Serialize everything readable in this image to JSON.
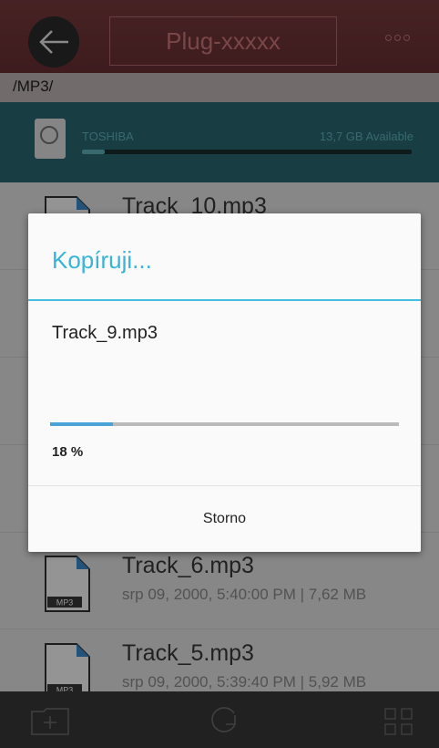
{
  "header": {
    "title": "Plug-xxxxx",
    "back_icon": "arrow-left-icon",
    "more_icon": "more-dots-icon"
  },
  "path": "/MP3/",
  "drive": {
    "name": "TOSHIBA",
    "available": "13,7 GB Available",
    "used_fraction": 0.07,
    "icon": "hard-drive-icon"
  },
  "files": [
    {
      "name": "Track_10.mp3",
      "meta": ""
    },
    {
      "name": "",
      "meta": ""
    },
    {
      "name": "",
      "meta": ""
    },
    {
      "name": "",
      "meta": ""
    },
    {
      "name": "Track_6.mp3",
      "meta": "srp 09, 2000, 5:40:00 PM | 7,62 MB",
      "badge": "MP3"
    },
    {
      "name": "Track_5.mp3",
      "meta": "srp 09, 2000, 5:39:40 PM | 5,92 MB",
      "badge": "MP3"
    }
  ],
  "dialog": {
    "title": "Kopíruji...",
    "filename": "Track_9.mp3",
    "progress_percent": 18,
    "progress_text": "18 %",
    "cancel_label": "Storno"
  },
  "bottom_bar": {
    "icons": [
      "new-folder-icon",
      "refresh-icon",
      "grid-view-icon"
    ]
  },
  "colors": {
    "header": "#6b2f33",
    "drive_bar": "#2a6a72",
    "accent": "#36b4da",
    "progress": "#4aa3d6"
  }
}
